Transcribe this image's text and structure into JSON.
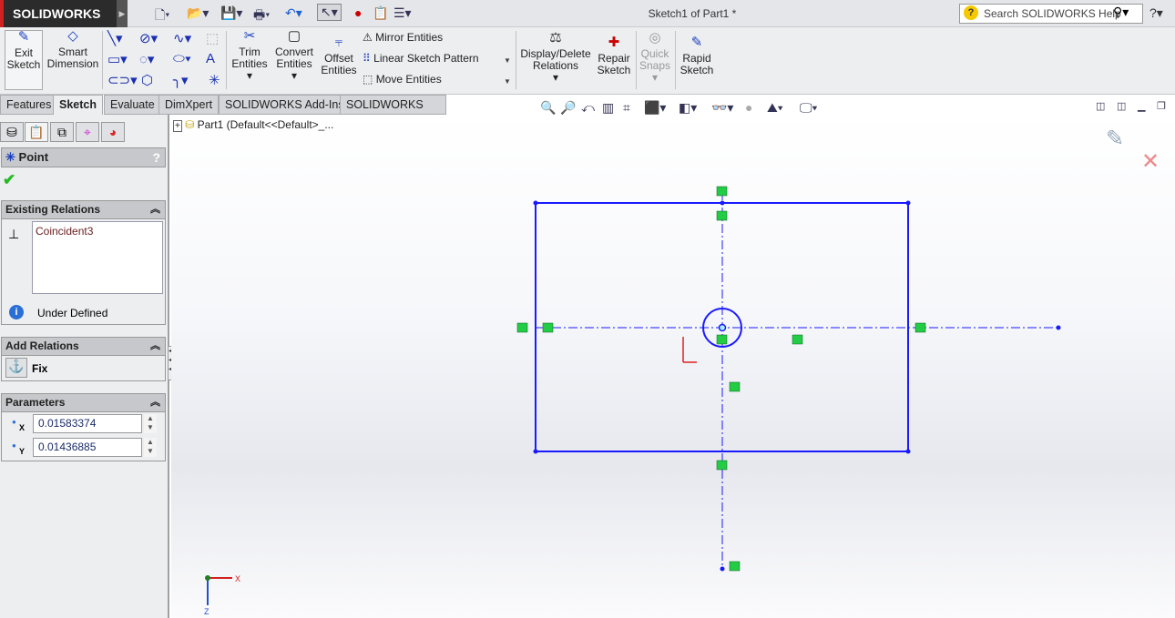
{
  "app": {
    "logo": "SOLIDWORKS",
    "title": "Sketch1 of Part1 *",
    "search_placeholder": "Search SOLIDWORKS Help"
  },
  "ribbon": {
    "exit_sketch": "Exit Sketch",
    "smart_dimension": "Smart Dimension",
    "trim_entities": "Trim Entities",
    "convert_entities": "Convert Entities",
    "offset_entities": "Offset Entities",
    "mirror_entities": "Mirror Entities",
    "linear_sketch_pattern": "Linear Sketch Pattern",
    "move_entities": "Move Entities",
    "display_delete_relations": "Display/Delete Relations",
    "repair_sketch": "Repair Sketch",
    "quick_snaps": "Quick Snaps",
    "rapid_sketch": "Rapid Sketch"
  },
  "tabs": [
    "Features",
    "Sketch",
    "Evaluate",
    "DimXpert",
    "SOLIDWORKS Add-Ins",
    "SOLIDWORKS MBD"
  ],
  "tree": {
    "root": "Part1  (Default<<Default>_..."
  },
  "property_manager": {
    "title": "Point",
    "existing_relations": {
      "header": "Existing Relations",
      "items": [
        "Coincident3"
      ],
      "status": "Under Defined"
    },
    "add_relations": {
      "header": "Add Relations",
      "items": [
        "Fix"
      ]
    },
    "parameters": {
      "header": "Parameters",
      "x_label": "X",
      "x_value": "0.01583374",
      "y_label": "Y",
      "y_value": "0.01436885"
    }
  },
  "triad": {
    "x": "X",
    "z": "Z"
  },
  "colors": {
    "sketch": "#1a1aff",
    "relation": "#22cc44",
    "accent": "#1c3fbf"
  }
}
